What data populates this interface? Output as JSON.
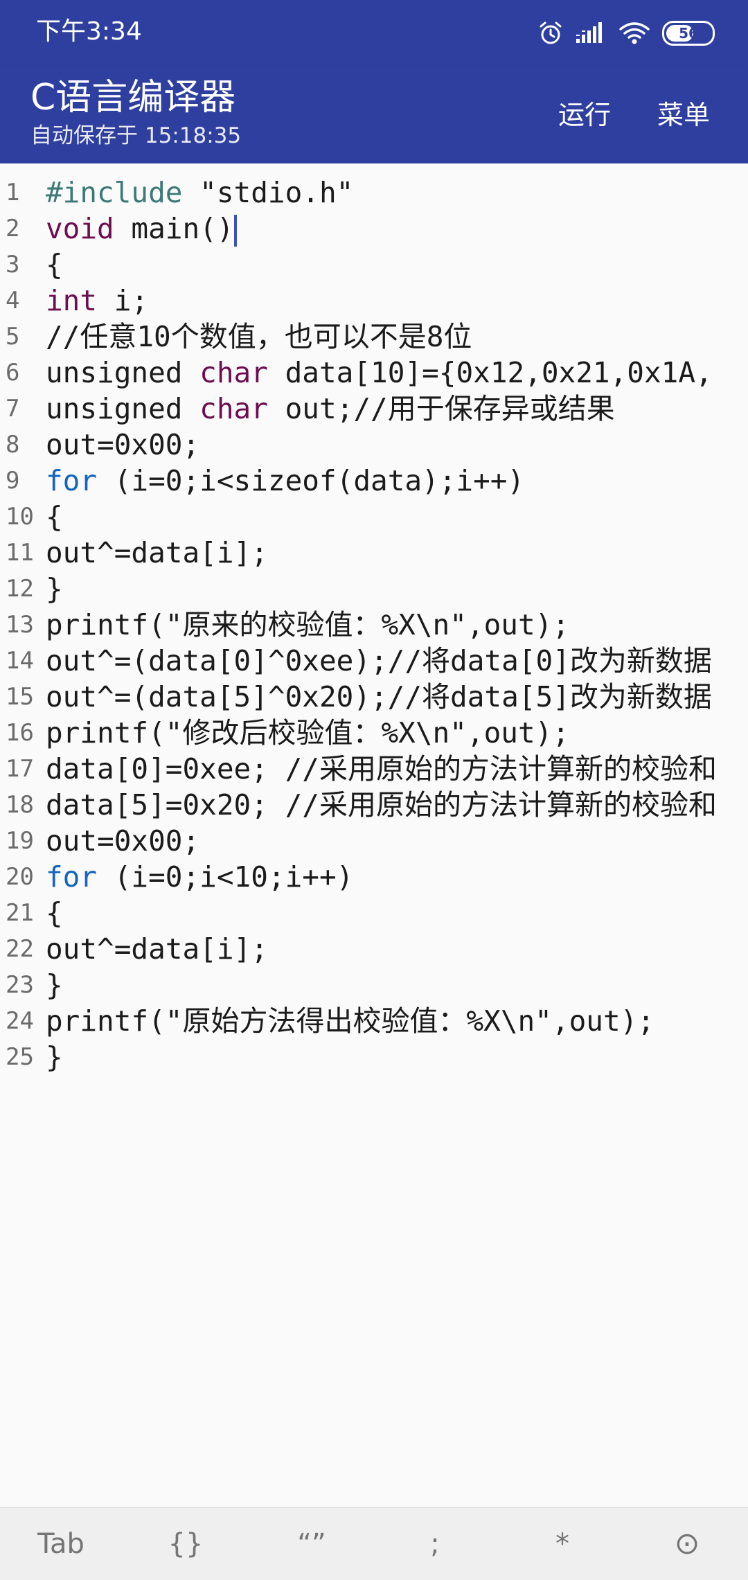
{
  "status_bar": {
    "time": "下午3:34",
    "icons": [
      "alarm-icon",
      "signal-icon",
      "wifi-icon"
    ],
    "battery": "56",
    "battery_level": 0.56
  },
  "app_bar": {
    "title": "C语言编译器",
    "subtitle": "自动保存于 15:18:35",
    "run_label": "运行",
    "menu_label": "菜单"
  },
  "editor": {
    "colors": {
      "keyword": "#6e0d4f",
      "for_keyword": "#1565c0",
      "preprocessor": "#3d7a76",
      "cursor": "#3f51b5"
    },
    "lines": [
      {
        "num": "1",
        "tokens": [
          {
            "t": "#include",
            "c": "pre"
          },
          {
            "t": " \"stdio.h\""
          }
        ]
      },
      {
        "num": "2",
        "tokens": [
          {
            "t": "void",
            "c": "kw"
          },
          {
            "t": " main()"
          }
        ],
        "cursor": true
      },
      {
        "num": "3",
        "tokens": [
          {
            "t": "{"
          }
        ]
      },
      {
        "num": "4",
        "tokens": [
          {
            "t": "int",
            "c": "kw"
          },
          {
            "t": " i;"
          }
        ]
      },
      {
        "num": "5",
        "tokens": [
          {
            "t": "//任意10个数值，也可以不是8位"
          }
        ]
      },
      {
        "num": "6",
        "tokens": [
          {
            "t": "unsigned "
          },
          {
            "t": "char",
            "c": "kw"
          },
          {
            "t": " data[10]={0x12,0x21,0x1A,"
          }
        ]
      },
      {
        "num": "7",
        "tokens": [
          {
            "t": "unsigned "
          },
          {
            "t": "char",
            "c": "kw"
          },
          {
            "t": " out;//用于保存异或结果"
          }
        ]
      },
      {
        "num": "8",
        "tokens": [
          {
            "t": "out=0x00;"
          }
        ]
      },
      {
        "num": "9",
        "tokens": [
          {
            "t": "for",
            "c": "for"
          },
          {
            "t": " (i=0;i<sizeof(data);i++)"
          }
        ]
      },
      {
        "num": "10",
        "tokens": [
          {
            "t": "{"
          }
        ]
      },
      {
        "num": "11",
        "tokens": [
          {
            "t": "out^=data[i];"
          }
        ]
      },
      {
        "num": "12",
        "tokens": [
          {
            "t": "}"
          }
        ]
      },
      {
        "num": "13",
        "tokens": [
          {
            "t": "printf(\"原来的校验值：%X\\n\",out);"
          }
        ]
      },
      {
        "num": "14",
        "tokens": [
          {
            "t": "out^=(data[0]^0xee);//将data[0]改为新数据"
          }
        ]
      },
      {
        "num": "15",
        "tokens": [
          {
            "t": "out^=(data[5]^0x20);//将data[5]改为新数据"
          }
        ]
      },
      {
        "num": "16",
        "tokens": [
          {
            "t": "printf(\"修改后校验值：%X\\n\",out);"
          }
        ]
      },
      {
        "num": "17",
        "tokens": [
          {
            "t": "data[0]=0xee; //采用原始的方法计算新的校验和"
          }
        ]
      },
      {
        "num": "18",
        "tokens": [
          {
            "t": "data[5]=0x20; //采用原始的方法计算新的校验和"
          }
        ]
      },
      {
        "num": "19",
        "tokens": [
          {
            "t": "out=0x00;"
          }
        ]
      },
      {
        "num": "20",
        "tokens": [
          {
            "t": "for",
            "c": "for"
          },
          {
            "t": " (i=0;i<10;i++)"
          }
        ]
      },
      {
        "num": "21",
        "tokens": [
          {
            "t": "{"
          }
        ]
      },
      {
        "num": "22",
        "tokens": [
          {
            "t": "out^=data[i];"
          }
        ]
      },
      {
        "num": "23",
        "tokens": [
          {
            "t": "}"
          }
        ]
      },
      {
        "num": "24",
        "tokens": [
          {
            "t": "printf(\"原始方法得出校验值：%X\\n\",out);"
          }
        ]
      },
      {
        "num": "25",
        "tokens": [
          {
            "t": "}"
          }
        ]
      }
    ]
  },
  "bottom_bar": {
    "keys": [
      {
        "label": "Tab",
        "name": "tab-key"
      },
      {
        "label": "{}",
        "name": "braces-key"
      },
      {
        "label": "“”",
        "name": "quotes-key"
      },
      {
        "label": ";",
        "name": "semicolon-key"
      },
      {
        "label": "*",
        "name": "asterisk-key"
      },
      {
        "label": "⊙",
        "name": "more-key"
      }
    ]
  }
}
